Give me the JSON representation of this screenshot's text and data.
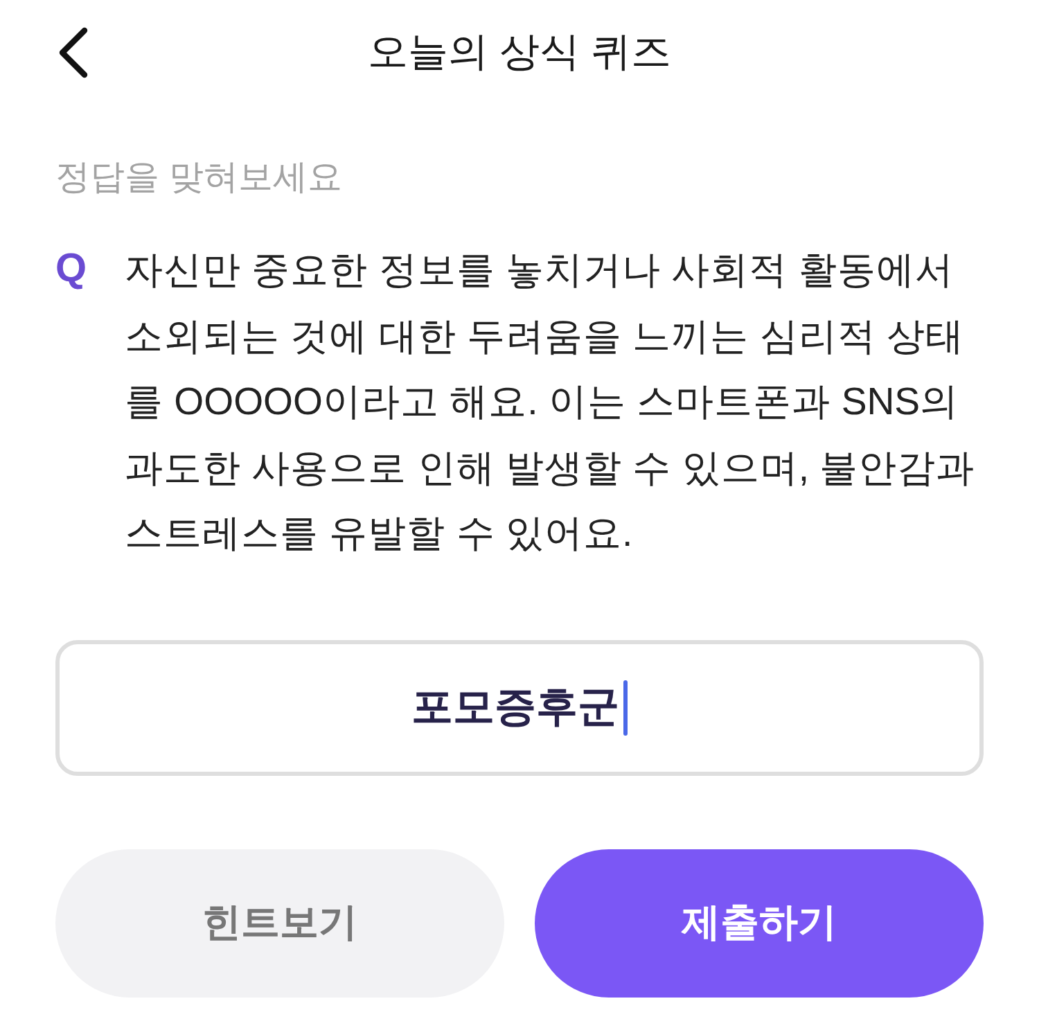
{
  "header": {
    "title": "오늘의 상식 퀴즈"
  },
  "instruction": "정답을 맞혀보세요",
  "question": {
    "marker": "Q",
    "text": "자신만 중요한 정보를 놓치거나 사회적 활동에서 소외되는 것에 대한 두려움을 느끼는 심리적 상태를 OOOOO이라고 해요. 이는 스마트폰과 SNS의 과도한 사용으로 인해 발생할 수 있으며, 불안감과 스트레스를 유발할 수 있어요."
  },
  "answer_field": {
    "value": "포모증후군",
    "focused": true
  },
  "buttons": [
    {
      "label": "힌트보기",
      "kind": "secondary"
    },
    {
      "label": "제출하기",
      "kind": "primary"
    }
  ]
}
